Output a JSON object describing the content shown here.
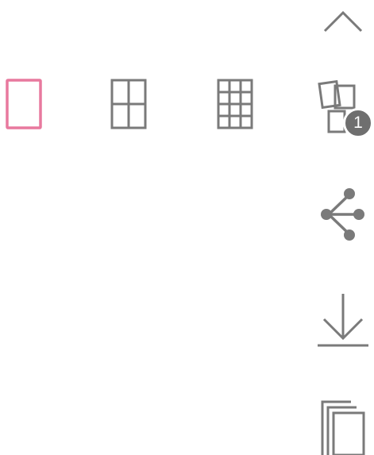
{
  "colors": {
    "icon": "#7a7a7a",
    "selected": "#e8799e",
    "badge_bg": "#6f6f6f",
    "badge_text": "#ffffff"
  },
  "toolbar": {
    "collapse_icon": "chevron-up-icon",
    "selection_badge_count": "1",
    "share_icon": "share-icon",
    "download_icon": "download-icon",
    "pages_icon": "pages-stack-icon"
  },
  "layout_options": {
    "selected_index": 0,
    "items": [
      {
        "icon": "layout-single-icon"
      },
      {
        "icon": "layout-grid-2x2-icon"
      },
      {
        "icon": "layout-grid-3x4-icon"
      }
    ]
  }
}
